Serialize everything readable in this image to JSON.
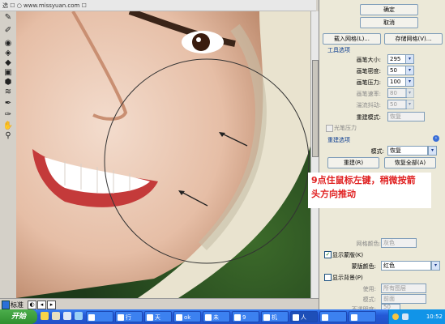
{
  "window": {
    "title": "选 ☐ ○ www.missyuan.com ☐"
  },
  "tools": [
    "forward-warp-icon",
    "reconstruct-icon",
    "twirl-icon",
    "pucker-icon",
    "bloat-icon",
    "push-left-icon",
    "mirror-icon",
    "turbulence-icon",
    "freeze-mask-icon",
    "thaw-mask-icon",
    "hand-icon",
    "zoom-icon"
  ],
  "panel": {
    "ok_label": "确定",
    "cancel_label": "取消",
    "load_mesh_label": "载入网格(L)...",
    "save_mesh_label": "存储网格(V)...",
    "tool_options_title": "工具选项",
    "brush_size_label": "画笔大小:",
    "brush_size_value": "295",
    "brush_density_label": "画笔密度:",
    "brush_density_value": "50",
    "brush_pressure_label": "画笔压力:",
    "brush_pressure_value": "100",
    "brush_rate_label": "画笔速率:",
    "brush_rate_value": "80",
    "turbulent_jitter_label": "湍流抖动:",
    "turbulent_jitter_value": "50",
    "reconstruct_mode_label": "重建模式:",
    "reconstruct_mode_value": "恢复",
    "stylus_pressure_label": "光笔压力",
    "reconstruct_options_title": "重建选项",
    "mode_label": "模式:",
    "mode_value": "恢复",
    "reconstruct_button": "重建(R)",
    "restore_all_button": "恢复全部(A)",
    "mesh_color_label": "网格颜色:",
    "mesh_color_value": "灰色",
    "show_mask_label": "显示蒙版(K)",
    "mask_color_label": "蒙版颜色:",
    "mask_color_value": "红色",
    "show_backdrop_label": "显示背景(P)",
    "use_label": "使用:",
    "use_value": "所有图层",
    "backdrop_mode_label": "模式:",
    "backdrop_mode_value": "前面",
    "opacity_label": "不透明度:",
    "opacity_value": "50"
  },
  "overlay": {
    "line1": "9点住鼠标左键，稍微按箭",
    "line2": "头方向推动"
  },
  "status": {
    "label": "标准"
  },
  "taskbar": {
    "start_label": "开始",
    "tasks": [
      "",
      "",
      "行",
      "天",
      "ok",
      "未",
      "9",
      "机",
      "人",
      "",
      "",
      ""
    ],
    "clock": "10:52"
  }
}
